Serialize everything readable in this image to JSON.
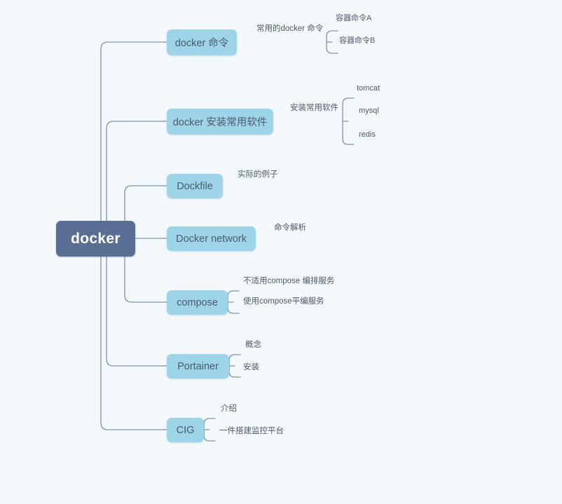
{
  "diagram": {
    "title": "docker",
    "type": "mind-map",
    "colors": {
      "background": "#f3f8fd",
      "root_fill": "#5a6e94",
      "root_text": "#ffffff",
      "branch_fill": "#9ed4e8",
      "branch_text": "#4a5c6b",
      "connector": "#7f93a8",
      "leaf_text": "#4f5a66"
    },
    "root": {
      "label": "docker"
    },
    "branches": [
      {
        "id": "docker-commands",
        "label": "docker 命令",
        "leaves": [
          {
            "label": "常用的docker 命令"
          }
        ],
        "sub_leaves": [
          {
            "label": "容器命令A"
          },
          {
            "label": "容器命令B"
          }
        ]
      },
      {
        "id": "docker-install-software",
        "label": "docker 安装常用软件",
        "leaves": [
          {
            "label": "安装常用软件"
          }
        ],
        "sub_leaves": [
          {
            "label": "tomcat"
          },
          {
            "label": "mysql"
          },
          {
            "label": "redis"
          }
        ]
      },
      {
        "id": "dockfile",
        "label": "Dockfile",
        "leaves": [
          {
            "label": "实际的例子"
          }
        ],
        "sub_leaves": []
      },
      {
        "id": "docker-network",
        "label": "Docker network",
        "leaves": [
          {
            "label": "命令解析"
          }
        ],
        "sub_leaves": []
      },
      {
        "id": "compose",
        "label": "compose",
        "leaves": [],
        "sub_leaves": [
          {
            "label": "不适用compose 编排服务"
          },
          {
            "label": "使用compose平编服务"
          }
        ]
      },
      {
        "id": "portainer",
        "label": "Portainer",
        "leaves": [],
        "sub_leaves": [
          {
            "label": "概念"
          },
          {
            "label": "安装"
          }
        ]
      },
      {
        "id": "cig",
        "label": "CIG",
        "leaves": [],
        "sub_leaves": [
          {
            "label": "介绍"
          },
          {
            "label": "一件搭建监控平台"
          }
        ]
      }
    ]
  }
}
